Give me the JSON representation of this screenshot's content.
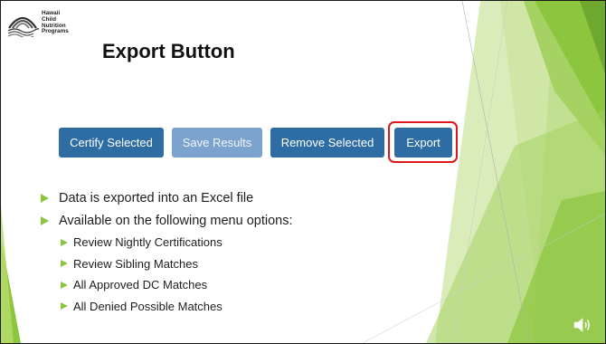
{
  "logo": {
    "text": "Hawaii\nChild\nNutrition\nPrograms",
    "icon": "rainbow-logo-icon"
  },
  "title": "Export Button",
  "buttons": {
    "certify": "Certify Selected",
    "save": "Save Results",
    "remove": "Remove Selected",
    "export": "Export"
  },
  "bullets": [
    "Data is exported into an Excel file",
    "Available on the following menu options:"
  ],
  "sub_bullets": [
    "Review Nightly Certifications",
    "Review Sibling Matches",
    "All Approved DC Matches",
    "All Denied Possible Matches"
  ],
  "colors": {
    "button_primary": "#2e6da4",
    "button_disabled": "#7ba3cd",
    "highlight": "#e0141b",
    "accent_green": "#8cc63f"
  },
  "icons": {
    "bullet": "triangle-bullet-icon",
    "audio": "speaker-icon"
  }
}
